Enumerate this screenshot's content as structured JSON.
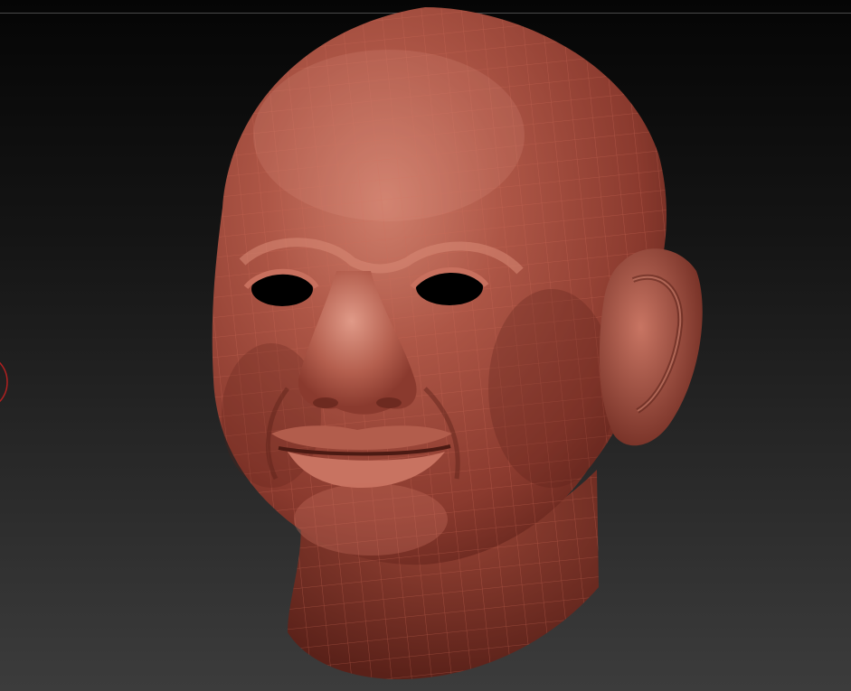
{
  "viewport": {
    "background_top": "#0c0c0c",
    "background_bottom": "#3a3a3a",
    "edge_line": "#4a4a4a"
  },
  "model": {
    "name": "head-mesh",
    "material_color": "#9a4538",
    "material_highlight": "#d0806e",
    "material_shadow": "#4f1d16",
    "wire_color": "#c5604e"
  },
  "brush_cursor": {
    "color": "#b02020"
  }
}
